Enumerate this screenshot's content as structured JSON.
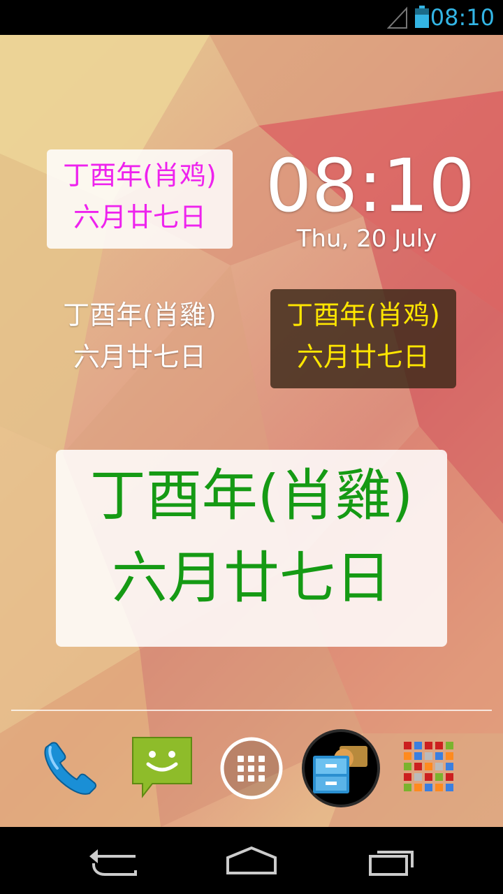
{
  "status_bar": {
    "time": "08:10",
    "icons": [
      "signal-icon",
      "battery-icon"
    ]
  },
  "clock_widget": {
    "time": "08:10",
    "date": "Thu, 20 July"
  },
  "lunar_widgets": [
    {
      "line1": "丁酉年(肖鸡)",
      "line2": "六月廿七日",
      "text_color": "#ee22ee",
      "style": "light-box"
    },
    {
      "line1": "丁酉年(肖雞)",
      "line2": "六月廿七日",
      "text_color": "#ffffff",
      "style": "transparent"
    },
    {
      "line1": "丁酉年(肖鸡)",
      "line2": "六月廿七日",
      "text_color": "#ffe600",
      "style": "dark-box"
    },
    {
      "line1": "丁酉年(肖雞)",
      "line2": "六月廿七日",
      "text_color": "#159a14",
      "style": "light-box-large"
    }
  ],
  "dock": {
    "icons": [
      "phone-icon",
      "messaging-icon",
      "app-drawer-icon",
      "file-manager-icon",
      "lunar-app-icon"
    ]
  },
  "nav_bar": {
    "buttons": [
      "back-icon",
      "home-icon",
      "recent-apps-icon"
    ]
  },
  "colors": {
    "status_accent": "#33b5e5"
  }
}
